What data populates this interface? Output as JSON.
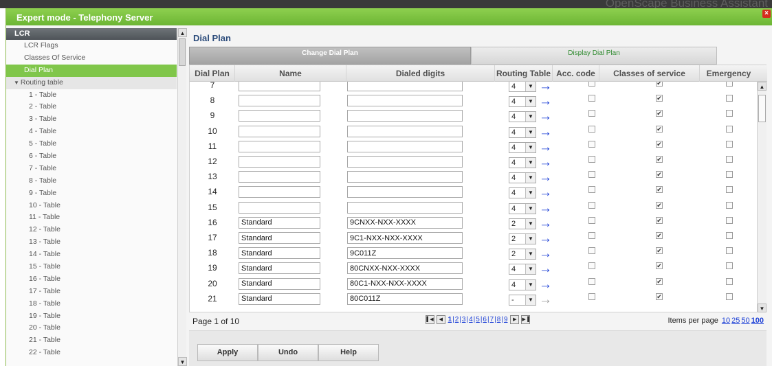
{
  "background": {
    "logo_text": "",
    "brand": "OpenScape Business Assistant"
  },
  "window": {
    "title": "Expert mode - Telephony Server",
    "close_label": "×"
  },
  "sidebar": {
    "header": "LCR",
    "items": [
      {
        "label": "LCR Flags"
      },
      {
        "label": "Classes Of Service"
      },
      {
        "label": "Dial Plan"
      }
    ],
    "group": {
      "label": "Routing table",
      "expand_icon": "▼"
    },
    "sub_items": [
      "1 - Table",
      "2 - Table",
      "3 - Table",
      "4 - Table",
      "5 - Table",
      "6 - Table",
      "7 - Table",
      "8 - Table",
      "9 - Table",
      "10 - Table",
      "11 - Table",
      "12 - Table",
      "13 - Table",
      "14 - Table",
      "15 - Table",
      "16 - Table",
      "17 - Table",
      "18 - Table",
      "19 - Table",
      "20 - Table",
      "21 - Table",
      "22 - Table"
    ],
    "scroll_up": "▲",
    "scroll_down": "▼"
  },
  "main": {
    "title": "Dial Plan",
    "tabs": [
      {
        "label": "Change Dial Plan",
        "active": true
      },
      {
        "label": "Display Dial Plan",
        "active": false
      }
    ],
    "columns": [
      "Dial Plan",
      "Name",
      "Dialed digits",
      "Routing Table",
      "Acc. code",
      "Classes of service",
      "Emergency"
    ],
    "rows": [
      {
        "plan": "7",
        "name": "",
        "digits": "",
        "routing": "4",
        "acc": false,
        "cos": true,
        "emergency": false,
        "arrow_enabled": true
      },
      {
        "plan": "8",
        "name": "",
        "digits": "",
        "routing": "4",
        "acc": false,
        "cos": true,
        "emergency": false,
        "arrow_enabled": true
      },
      {
        "plan": "9",
        "name": "",
        "digits": "",
        "routing": "4",
        "acc": false,
        "cos": true,
        "emergency": false,
        "arrow_enabled": true
      },
      {
        "plan": "10",
        "name": "",
        "digits": "",
        "routing": "4",
        "acc": false,
        "cos": true,
        "emergency": false,
        "arrow_enabled": true
      },
      {
        "plan": "11",
        "name": "",
        "digits": "",
        "routing": "4",
        "acc": false,
        "cos": true,
        "emergency": false,
        "arrow_enabled": true
      },
      {
        "plan": "12",
        "name": "",
        "digits": "",
        "routing": "4",
        "acc": false,
        "cos": true,
        "emergency": false,
        "arrow_enabled": true
      },
      {
        "plan": "13",
        "name": "",
        "digits": "",
        "routing": "4",
        "acc": false,
        "cos": true,
        "emergency": false,
        "arrow_enabled": true
      },
      {
        "plan": "14",
        "name": "",
        "digits": "",
        "routing": "4",
        "acc": false,
        "cos": true,
        "emergency": false,
        "arrow_enabled": true
      },
      {
        "plan": "15",
        "name": "",
        "digits": "",
        "routing": "4",
        "acc": false,
        "cos": true,
        "emergency": false,
        "arrow_enabled": true
      },
      {
        "plan": "16",
        "name": "Standard",
        "digits": "9CNXX-NXX-XXXX",
        "routing": "2",
        "acc": false,
        "cos": true,
        "emergency": false,
        "arrow_enabled": true
      },
      {
        "plan": "17",
        "name": "Standard",
        "digits": "9C1-NXX-NXX-XXXX",
        "routing": "2",
        "acc": false,
        "cos": true,
        "emergency": false,
        "arrow_enabled": true
      },
      {
        "plan": "18",
        "name": "Standard",
        "digits": "9C011Z",
        "routing": "2",
        "acc": false,
        "cos": true,
        "emergency": false,
        "arrow_enabled": true
      },
      {
        "plan": "19",
        "name": "Standard",
        "digits": "80CNXX-NXX-XXXX",
        "routing": "4",
        "acc": false,
        "cos": true,
        "emergency": false,
        "arrow_enabled": true
      },
      {
        "plan": "20",
        "name": "Standard",
        "digits": "80C1-NXX-NXX-XXXX",
        "routing": "4",
        "acc": false,
        "cos": true,
        "emergency": false,
        "arrow_enabled": true
      },
      {
        "plan": "21",
        "name": "Standard",
        "digits": "80C011Z",
        "routing": "-",
        "acc": false,
        "cos": true,
        "emergency": false,
        "arrow_enabled": false
      }
    ],
    "pager": {
      "info": "Page 1 of 10",
      "pages": [
        "1",
        "2",
        "3",
        "4",
        "5",
        "6",
        "7",
        "8",
        "9"
      ],
      "current_page": "1",
      "items_per_page_label": "Items per page",
      "items_per_page_options": [
        "10",
        "25",
        "50",
        "100"
      ],
      "items_per_page_selected": "100"
    },
    "buttons": {
      "apply": "Apply",
      "undo": "Undo",
      "help": "Help"
    },
    "dropdown_icon": "▼",
    "route_arrow": "→"
  },
  "colors": {
    "accent_green": "#80c64a",
    "link_blue": "#1a3ed6",
    "title_blue": "#2a4a7a"
  }
}
